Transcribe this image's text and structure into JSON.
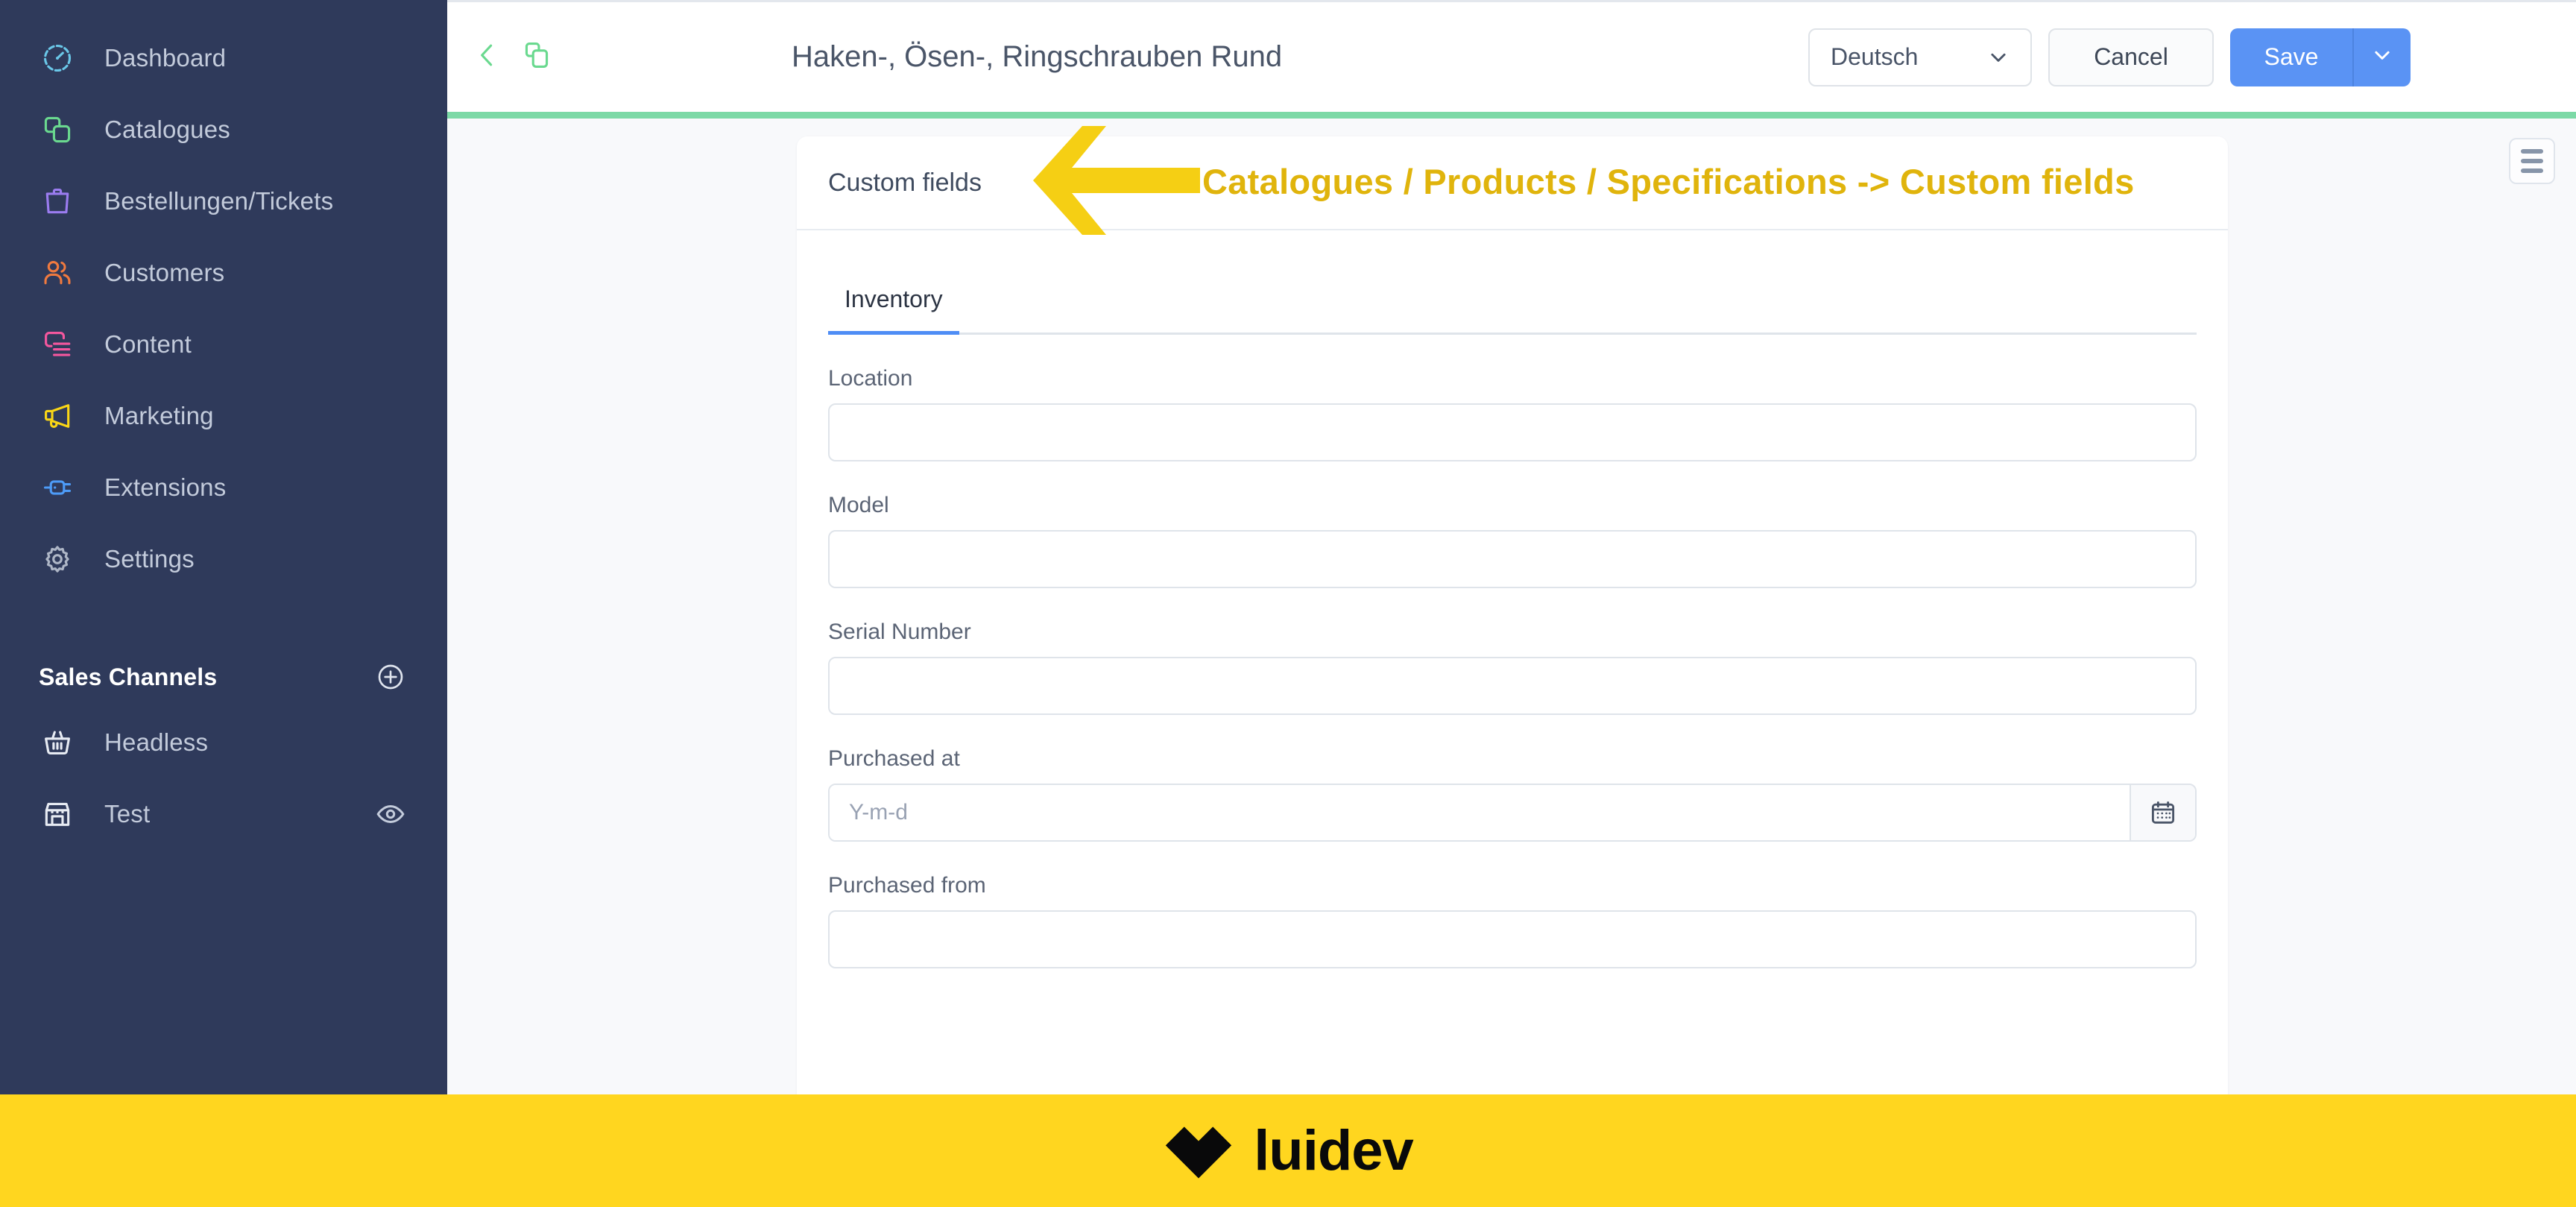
{
  "sidebar": {
    "items": [
      {
        "label": "Dashboard",
        "icon": "gauge-icon",
        "color": "#6ac7e8"
      },
      {
        "label": "Catalogues",
        "icon": "copy-icon",
        "color": "#6ad98f"
      },
      {
        "label": "Bestellungen/Tickets",
        "icon": "bag-icon",
        "color": "#9b7cf0"
      },
      {
        "label": "Customers",
        "icon": "users-icon",
        "color": "#f07a3f"
      },
      {
        "label": "Content",
        "icon": "content-icon",
        "color": "#f4579e"
      },
      {
        "label": "Marketing",
        "icon": "megaphone-icon",
        "color": "#fad616"
      },
      {
        "label": "Extensions",
        "icon": "plug-icon",
        "color": "#4d9bf7"
      },
      {
        "label": "Settings",
        "icon": "gear-icon",
        "color": "#aeb6c6"
      }
    ],
    "sales_channels": {
      "title": "Sales Channels",
      "add_icon": "plus-circle-icon",
      "items": [
        {
          "label": "Headless",
          "icon": "basket-icon",
          "trailing_icon": ""
        },
        {
          "label": "Test",
          "icon": "storefront-icon",
          "trailing_icon": "eye-icon"
        }
      ]
    }
  },
  "header": {
    "back_icon": "chevron-left-icon",
    "duplicate_icon": "copy-icon",
    "title": "Haken-, Ösen-, Ringschrauben Rund",
    "language": {
      "value": "Deutsch",
      "caret_icon": "chevron-down-icon"
    },
    "cancel_label": "Cancel",
    "save_label": "Save",
    "save_caret_icon": "chevron-down-icon"
  },
  "main": {
    "menu_icon": "hamburger-icon",
    "card_title": "Custom fields",
    "tabs": [
      {
        "label": "Inventory",
        "active": true
      }
    ],
    "fields": [
      {
        "name": "location",
        "label": "Location",
        "value": "",
        "placeholder": "",
        "addon_icon": ""
      },
      {
        "name": "model",
        "label": "Model",
        "value": "",
        "placeholder": "",
        "addon_icon": ""
      },
      {
        "name": "serial-number",
        "label": "Serial Number",
        "value": "",
        "placeholder": "",
        "addon_icon": ""
      },
      {
        "name": "purchased-at",
        "label": "Purchased at",
        "value": "",
        "placeholder": "Y-m-d",
        "addon_icon": "calendar-icon"
      },
      {
        "name": "purchased-from",
        "label": "Purchased from",
        "value": "",
        "placeholder": "",
        "addon_icon": ""
      }
    ]
  },
  "annotation": {
    "arrow_icon": "arrow-left-icon",
    "text": "Catalogues / Products / Specifications -> Custom fields",
    "color": "#e0b40c"
  },
  "brand": {
    "logo_icon": "heart-logo-icon",
    "name": "luidev",
    "background": "#ffd61f"
  },
  "colors": {
    "sidebar_bg": "#2f3a5b",
    "accent_green": "#7cd9a6",
    "primary_blue": "#5a93f4",
    "page_bg": "#f8f9fb",
    "brand_yellow": "#ffd61f"
  }
}
